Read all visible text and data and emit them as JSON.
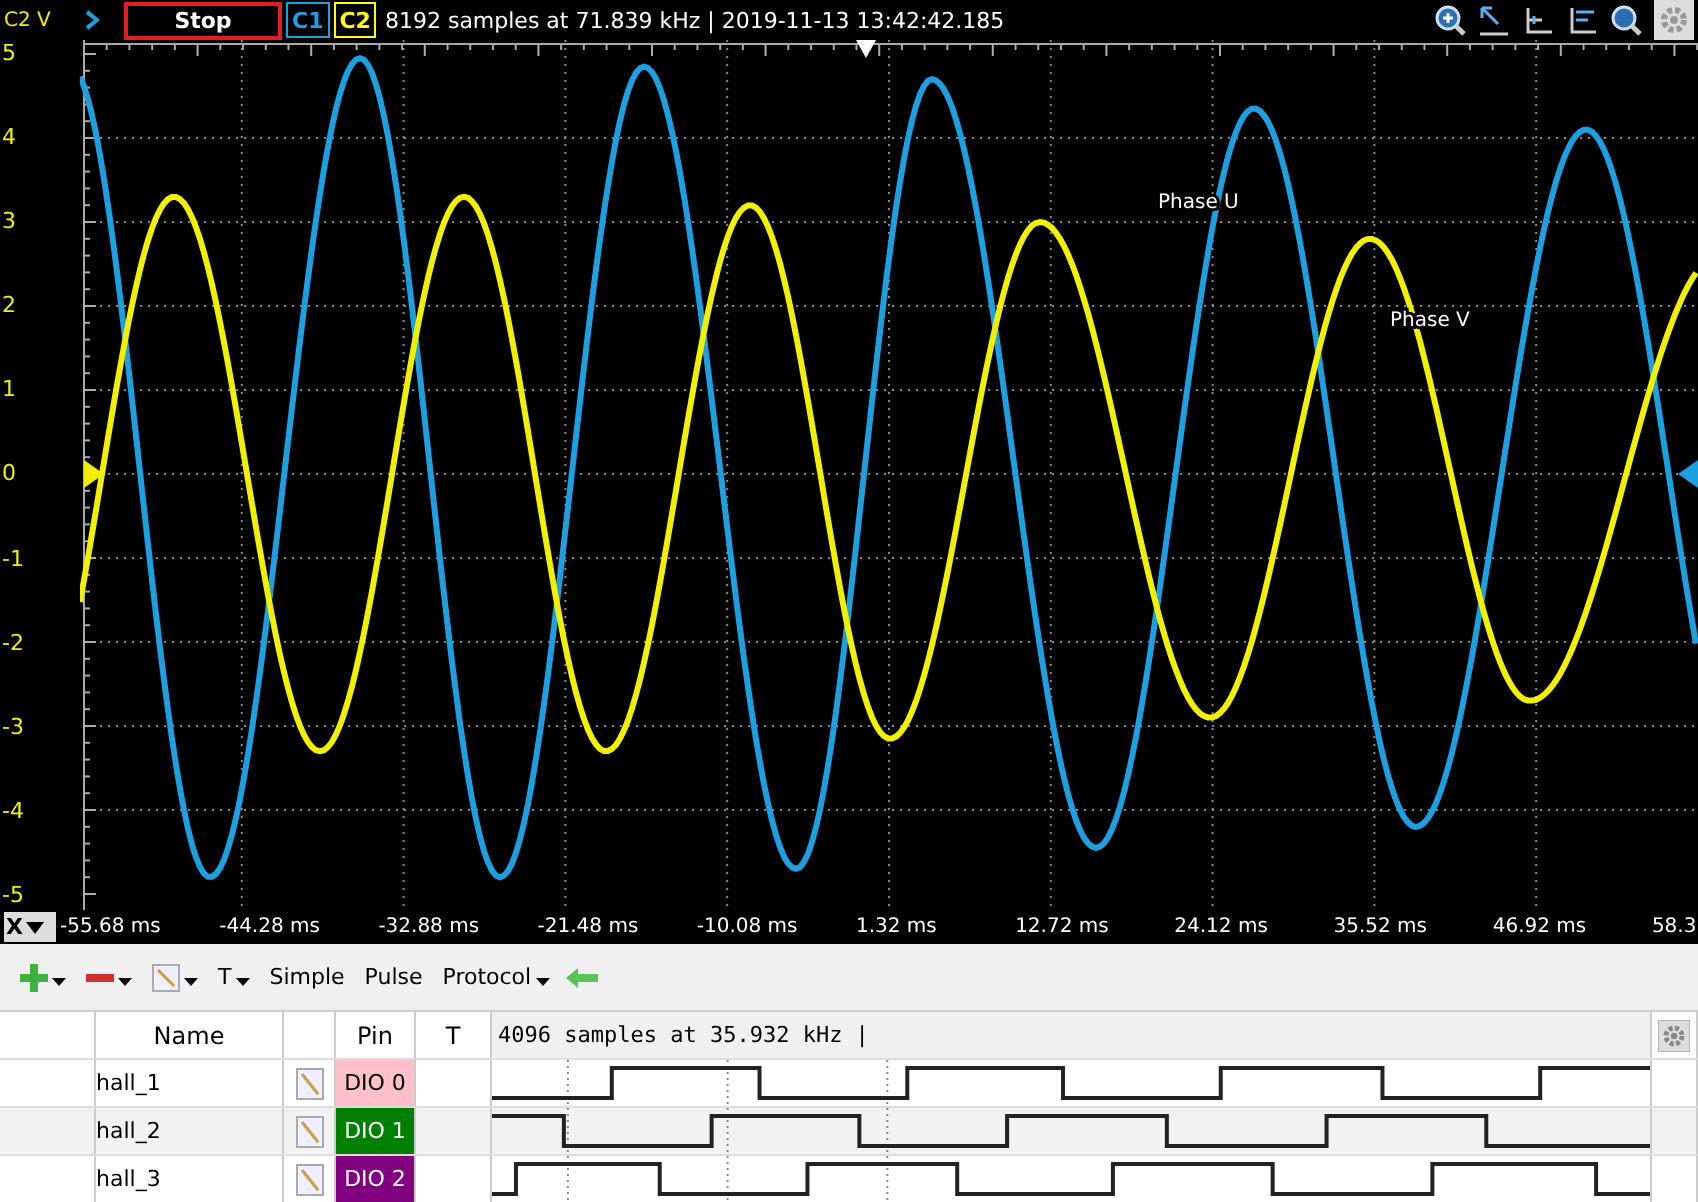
{
  "top_bar": {
    "run_button": {
      "label": "Stop"
    },
    "channels": [
      {
        "label": "C1",
        "color": "#1e9fe0"
      },
      {
        "label": "C2",
        "color": "#ffff00"
      }
    ],
    "info": "8192 samples at 71.839 kHz | 2019-11-13 13:42:42.185"
  },
  "plot": {
    "y_label": "C2 V",
    "y_ticks": [
      "5",
      "4",
      "3",
      "2",
      "1",
      "0",
      "-1",
      "-2",
      "-3",
      "-4",
      "-5"
    ],
    "traces": [
      {
        "label": "Phase U",
        "color": "#1e9fe0"
      },
      {
        "label": "Phase V",
        "color": "#f0f000"
      }
    ]
  },
  "x_axis": {
    "label": "X",
    "ticks": [
      "-55.68 ms",
      "-44.28 ms",
      "-32.88 ms",
      "-21.48 ms",
      "-10.08 ms",
      "1.32 ms",
      "12.72 ms",
      "24.12 ms",
      "35.52 ms",
      "46.92 ms",
      "58.3"
    ]
  },
  "toolbar": {
    "buttons": [
      {
        "label": "T",
        "dropdown": true
      },
      {
        "label": "Simple",
        "dropdown": false
      },
      {
        "label": "Pulse",
        "dropdown": false
      },
      {
        "label": "Protocol",
        "dropdown": true
      }
    ]
  },
  "logic": {
    "columns": [
      "Name",
      "Pin",
      "T"
    ],
    "info": "4096 samples at 35.932 kHz |",
    "rows": [
      {
        "name": "hall_1",
        "pin": "DIO 0",
        "color": "#ffc0cb"
      },
      {
        "name": "hall_2",
        "pin": "DIO 1",
        "color": "#008000"
      },
      {
        "name": "hall_3",
        "pin": "DIO 2",
        "color": "#800080"
      }
    ]
  }
}
